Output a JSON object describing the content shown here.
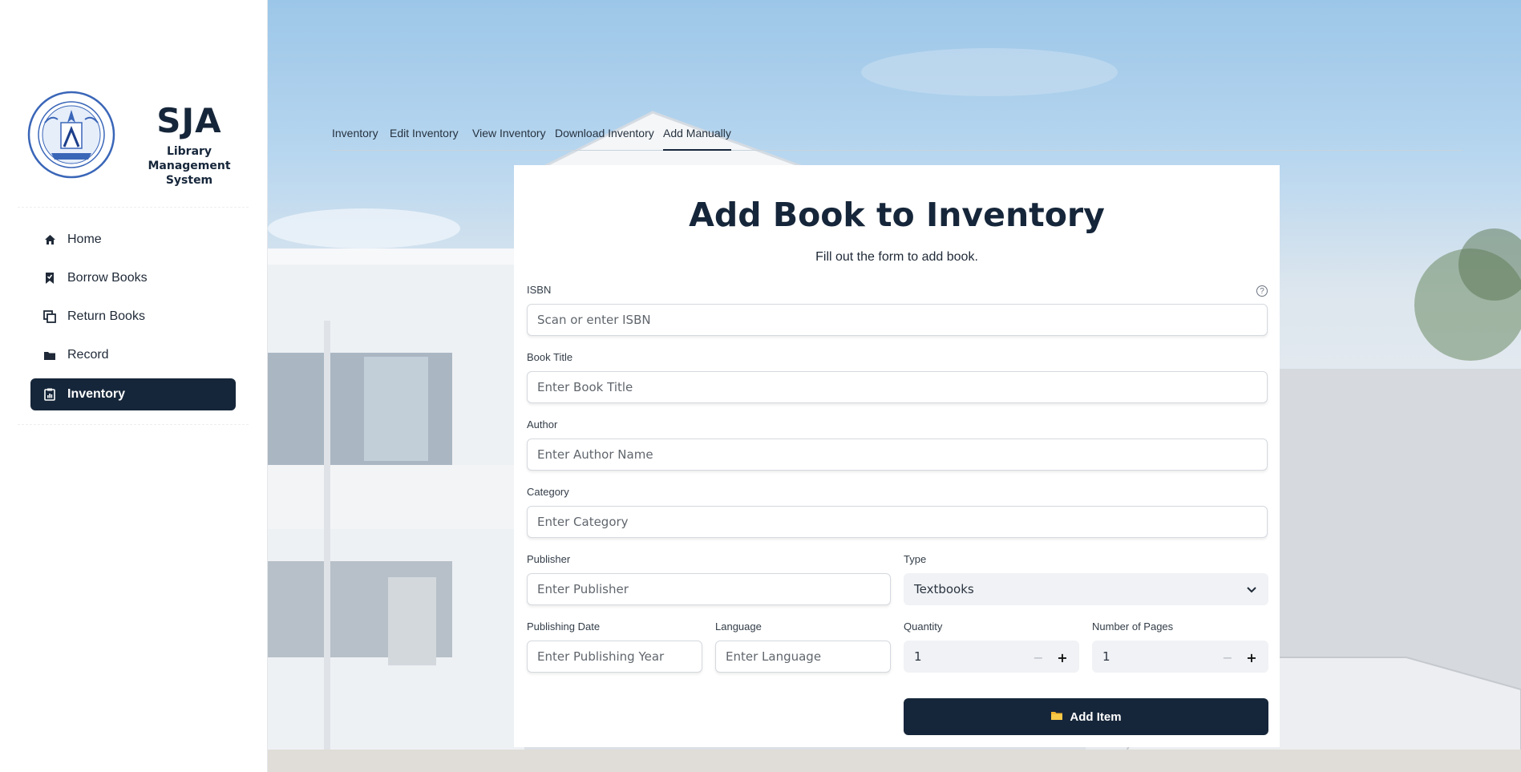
{
  "brand": {
    "name": "SJA",
    "subtitle_line1": "Library Management",
    "subtitle_line2": "System",
    "seal_text_top": "ST JOSEPH ACADEMY",
    "seal_text_bottom": "SAN JOSE, BATANGAS"
  },
  "sidebar": {
    "items": [
      {
        "label": "Home",
        "icon": "home-icon",
        "active": false
      },
      {
        "label": "Borrow Books",
        "icon": "bookmark-icon",
        "active": false
      },
      {
        "label": "Return Books",
        "icon": "copy-icon",
        "active": false
      },
      {
        "label": "Record",
        "icon": "folder-icon",
        "active": false
      },
      {
        "label": "Inventory",
        "icon": "clipboard-icon",
        "active": true
      }
    ]
  },
  "tabs": [
    "Inventory",
    "Edit Inventory",
    "View Inventory",
    "Download Inventory",
    "Add Manually"
  ],
  "active_tab": "Add Manually",
  "form": {
    "title": "Add Book to Inventory",
    "subtitle": "Fill out the form to add book.",
    "isbn": {
      "label": "ISBN",
      "placeholder": "Scan or enter ISBN"
    },
    "title_field": {
      "label": "Book Title",
      "placeholder": "Enter Book Title"
    },
    "author": {
      "label": "Author",
      "placeholder": "Enter Author Name"
    },
    "category": {
      "label": "Category",
      "placeholder": "Enter Category"
    },
    "publisher": {
      "label": "Publisher",
      "placeholder": "Enter Publisher"
    },
    "type": {
      "label": "Type",
      "value": "Textbooks"
    },
    "publishing_date": {
      "label": "Publishing Date",
      "placeholder": "Enter Publishing Year"
    },
    "language": {
      "label": "Language",
      "placeholder": "Enter Language"
    },
    "quantity": {
      "label": "Quantity",
      "value": "1"
    },
    "pages": {
      "label": "Number of Pages",
      "value": "1"
    },
    "submit_label": "Add Item",
    "stepper_minus": "−",
    "stepper_plus": "+"
  },
  "colors": {
    "primary": "#16263a",
    "sky": "#9cc6e8"
  }
}
